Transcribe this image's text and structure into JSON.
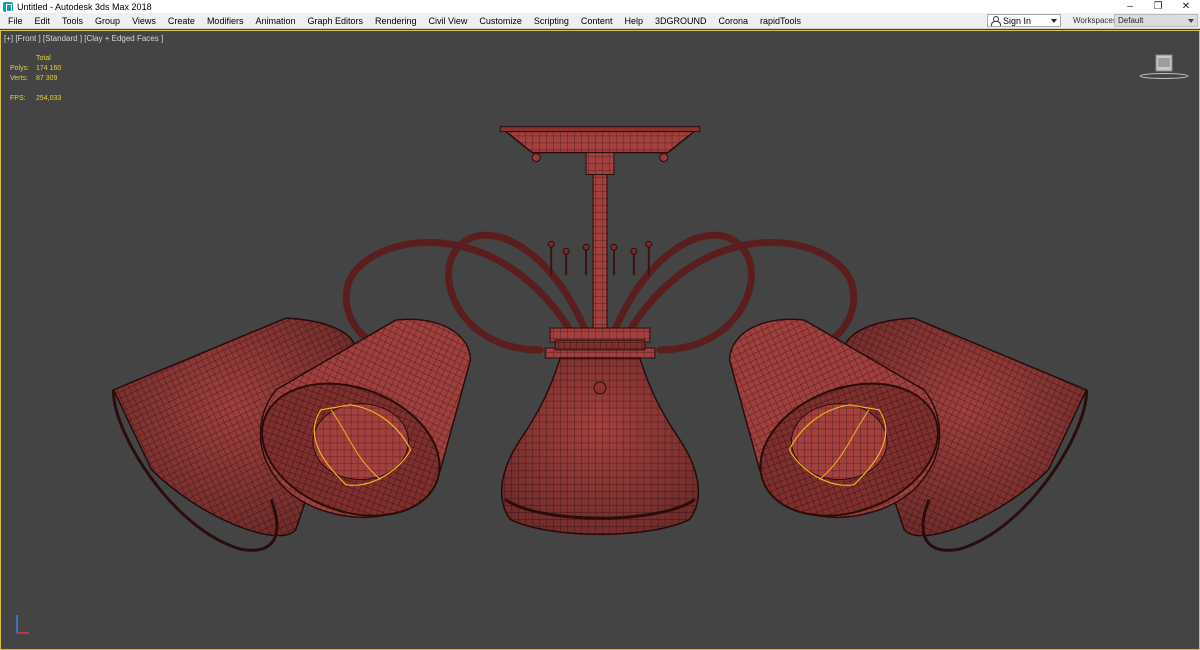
{
  "window": {
    "title": "Untitled - Autodesk 3ds Max 2018",
    "controls": {
      "minimize": "–",
      "restore": "❐",
      "close": "✕"
    }
  },
  "menu": {
    "items": [
      "File",
      "Edit",
      "Tools",
      "Group",
      "Views",
      "Create",
      "Modifiers",
      "Animation",
      "Graph Editors",
      "Rendering",
      "Civil View",
      "Customize",
      "Scripting",
      "Content",
      "Help",
      "3DGROUND",
      "Corona",
      "rapidTools"
    ],
    "signin_label": "Sign In",
    "workspaces_label": "Workspaces:",
    "workspaces_value": "Default"
  },
  "viewport": {
    "label": "[+] [Front ] [Standard ] [Clay + Edged Faces ]",
    "stats": {
      "total_label": "Total",
      "polys_label": "Polys:",
      "polys_value": "174 160",
      "verts_label": "Verts:",
      "verts_value": "87 309",
      "fps_label": "FPS:",
      "fps_value": "254,033"
    },
    "colors": {
      "background": "#444444",
      "border": "#d8c23a",
      "model": "#a0403e",
      "wire": "#3a1414",
      "selection": "#f0b020"
    }
  }
}
